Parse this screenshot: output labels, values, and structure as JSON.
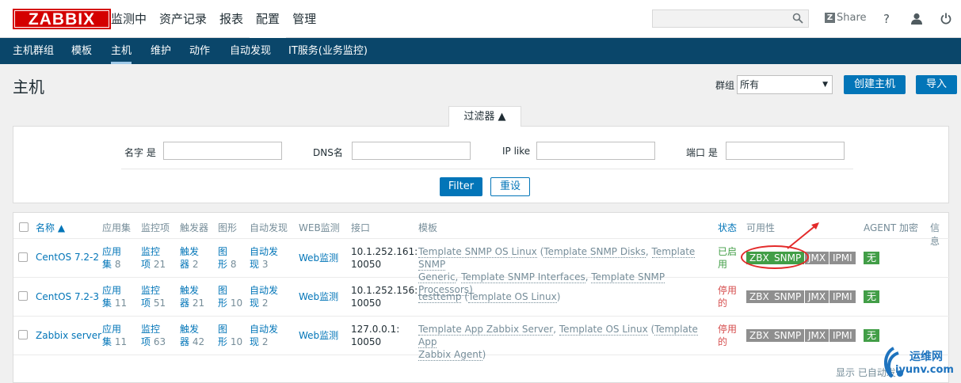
{
  "topbar": {
    "logo": "ZABBIX",
    "menu": [
      "监测中",
      "资产记录",
      "报表",
      "配置",
      "管理"
    ],
    "share": "Share",
    "help": "?"
  },
  "submenu": [
    "主机群组",
    "模板",
    "主机",
    "维护",
    "动作",
    "自动发现",
    "IT服务(业务监控)"
  ],
  "header": {
    "title": "主机",
    "group_label": "群组",
    "group_value": "所有",
    "create_button": "创建主机",
    "import_button": "导入"
  },
  "filter": {
    "tab_label": "过滤器 ▲",
    "name_label": "名字 是",
    "dns_label": "DNS名",
    "ip_label": "IP like",
    "port_label": "端口 是",
    "filter_button": "Filter",
    "reset_button": "重设"
  },
  "table": {
    "headers": [
      "名称 ▲",
      "应用集",
      "监控项",
      "触发器",
      "图形",
      "自动发现",
      "WEB监测",
      "接口",
      "模板",
      "状态",
      "可用性",
      "AGENT 加密",
      "信息"
    ],
    "rows": [
      {
        "name": "CentOS 7.2-2",
        "apps": [
          "应用",
          "集"
        ],
        "apps_count": "8",
        "items": [
          "监控",
          "项"
        ],
        "items_count": "21",
        "triggers": [
          "触发",
          "器"
        ],
        "triggers_count": "2",
        "graphs": [
          "图",
          "形"
        ],
        "graphs_count": "8",
        "discovery": [
          "自动发",
          "现"
        ],
        "discovery_count": "3",
        "web": "Web监测",
        "iface": [
          "10.1.252.161:",
          "10050"
        ],
        "tmpl_line1": [
          "Template SNMP OS Linux",
          " (",
          "Template SNMP Disks",
          ", ",
          "Template SNMP"
        ],
        "tmpl_line2": [
          "Generic",
          ", ",
          "Template SNMP Interfaces",
          ", ",
          "Template SNMP Processors",
          ")"
        ],
        "status": [
          "已启",
          "用"
        ],
        "agent": "无"
      },
      {
        "name": "CentOS 7.2-3",
        "apps": [
          "应用",
          "集"
        ],
        "apps_count": "11",
        "items": [
          "监控",
          "项"
        ],
        "items_count": "51",
        "triggers": [
          "触发",
          "器"
        ],
        "triggers_count": "21",
        "graphs": [
          "图",
          "形"
        ],
        "graphs_count": "10",
        "discovery": [
          "自动发",
          "现"
        ],
        "discovery_count": "2",
        "web": "Web监测",
        "iface": [
          "10.1.252.156:",
          "10050"
        ],
        "tmpl_line1": [
          "testtemp",
          " (",
          "Template OS Linux",
          ")"
        ],
        "status": [
          "停用",
          "的"
        ],
        "agent": "无"
      },
      {
        "name": "Zabbix server",
        "apps": [
          "应用",
          "集"
        ],
        "apps_count": "11",
        "items": [
          "监控",
          "项"
        ],
        "items_count": "63",
        "triggers": [
          "触发",
          "器"
        ],
        "triggers_count": "42",
        "graphs": [
          "图",
          "形"
        ],
        "graphs_count": "10",
        "discovery": [
          "自动发",
          "现"
        ],
        "discovery_count": "2",
        "web": "Web监测",
        "iface": [
          "127.0.0.1:",
          "10050"
        ],
        "tmpl_line1": [
          "Template App Zabbix Server",
          ", ",
          "Template OS Linux",
          " (",
          "Template App"
        ],
        "tmpl_line2": [
          "Zabbix Agent",
          ")"
        ],
        "status": [
          "停用",
          "的"
        ],
        "agent": "无"
      }
    ],
    "availability": [
      "ZBX",
      "SNMP",
      "JMX",
      "IPMI"
    ],
    "footer": "显示 已自动发"
  },
  "watermark": {
    "line1": "运维网",
    "line2": "iyunv.com"
  },
  "colors": {
    "brand": "#d40000",
    "nav": "#0a466a",
    "accent": "#0275b8",
    "green": "#429e47",
    "red": "#d64e4e",
    "gray_tag": "#8f8f8f"
  }
}
